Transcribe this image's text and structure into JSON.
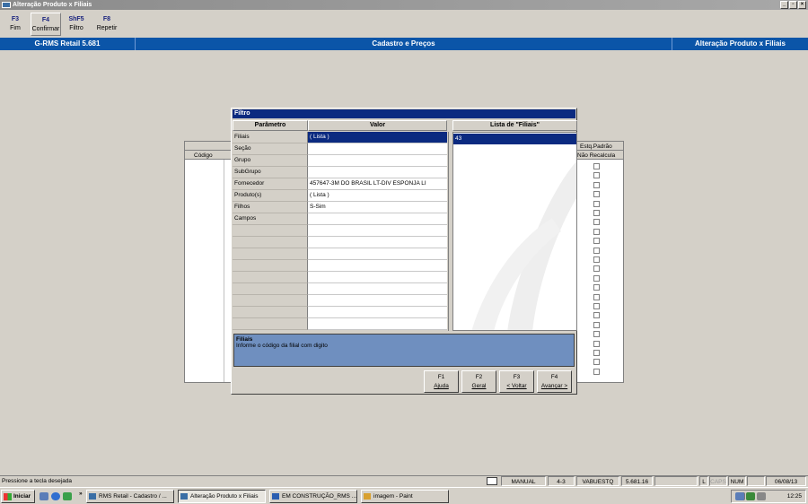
{
  "window": {
    "title": "Alteração Produto x Filiais",
    "min": "_",
    "max": "▫",
    "close": "×"
  },
  "toolbar": [
    {
      "key": "F3",
      "label": "Fim"
    },
    {
      "key": "F4",
      "label": "Confirmar"
    },
    {
      "key": "ShF5",
      "label": "Filtro"
    },
    {
      "key": "F8",
      "label": "Repetir"
    }
  ],
  "header": {
    "app": "G-RMS Retail 5.681",
    "module": "Cadastro e Preços",
    "screen": "Alteração Produto x Filiais"
  },
  "grid": {
    "col_codigo": "Código",
    "col_estq_top": "Estq.Padrão",
    "col_estq_bottom": "Não Recalcula"
  },
  "dialog": {
    "title": "Filtro",
    "col_param": "Parâmetro",
    "col_valor": "Valor",
    "list_title": "Lista de \"Filiais\"",
    "params": [
      {
        "name": "Filiais",
        "value": "( Lista )",
        "selected": true
      },
      {
        "name": "Seção",
        "value": ""
      },
      {
        "name": "Grupo",
        "value": ""
      },
      {
        "name": "SubGrupo",
        "value": ""
      },
      {
        "name": "Fornecedor",
        "value": "457647-3M DO BRASIL LT-DIV ESPONJA LI"
      },
      {
        "name": "Produto(s)",
        "value": "( Lista )"
      },
      {
        "name": "Filhos",
        "value": "S-Sim"
      },
      {
        "name": "Campos",
        "value": ""
      },
      {
        "name": "",
        "value": ""
      },
      {
        "name": "",
        "value": ""
      },
      {
        "name": "",
        "value": ""
      },
      {
        "name": "",
        "value": ""
      },
      {
        "name": "",
        "value": ""
      },
      {
        "name": "",
        "value": ""
      },
      {
        "name": "",
        "value": ""
      },
      {
        "name": "",
        "value": ""
      },
      {
        "name": "",
        "value": ""
      }
    ],
    "list_items": [
      "43"
    ],
    "help_title": "Filiais",
    "help_text": "Informe o código da filial com digito",
    "buttons": [
      {
        "key": "F1",
        "label": "Ajuda"
      },
      {
        "key": "F2",
        "label": "Geral"
      },
      {
        "key": "F3",
        "label": "< Voltar"
      },
      {
        "key": "F4",
        "label": "Avançar >"
      }
    ]
  },
  "status": {
    "message": "Pressione a tecla desejada",
    "mode": "MANUAL",
    "code": "4-3",
    "user": "VABUESTQ",
    "version": "5.681.16",
    "l": "L",
    "caps": "CAPS",
    "num": "NUM",
    "date": "06/08/13"
  },
  "taskbar": {
    "start": "Iniciar",
    "chevron": "»",
    "tasks": [
      "RMS Retail - Cadastro / ...",
      "Alteração Produto x Filiais",
      "EM CONSTRUÇÃO_RMS ...",
      "imagem - Paint"
    ],
    "clock": "12:25"
  }
}
